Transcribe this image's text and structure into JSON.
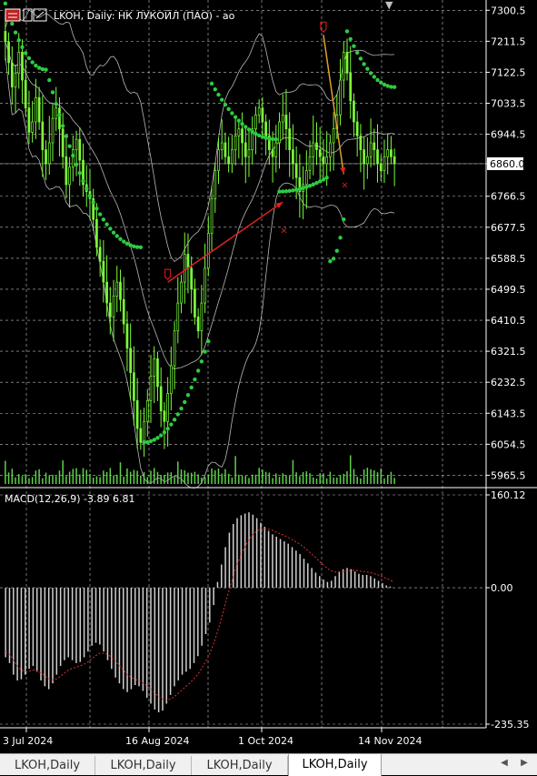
{
  "window": {
    "title": "LKOH, Daily:  НК ЛУКОЙЛ (ПАО) - ао"
  },
  "colors": {
    "background": "#000000",
    "grid": "#c0c0c0",
    "candle": "#7cfc3a",
    "sar": "#2ecc40",
    "bands": "#b8b8b8",
    "volume": "#5fd04a",
    "arrow": "#e02020",
    "price_label_bg": "#ffffff",
    "macd_histogram": "#d0d0d0",
    "macd_signal": "#e03030"
  },
  "chart_data": [
    {
      "type": "candlestick",
      "title": "LKOH, Daily:  НК ЛУКОЙЛ (ПАО) - ао",
      "x_tick_labels": [
        "3 Jul 2024",
        "16 Aug 2024",
        "1 Oct 2024",
        "14 Nov 2024"
      ],
      "y_tick_labels": [
        "7300.5",
        "7211.5",
        "7122.5",
        "7033.5",
        "6944.5",
        "6860.0",
        "6766.5",
        "6677.5",
        "6588.5",
        "6499.5",
        "6410.5",
        "6321.5",
        "6232.5",
        "6143.5",
        "6054.5",
        "5965.5"
      ],
      "current_price": "6860.0",
      "ylim": [
        5930,
        7330
      ],
      "grid": true,
      "indicators": [
        "Parabolic SAR",
        "Bollinger Bands",
        "Volume"
      ],
      "close_series": [
        7210,
        7150,
        7080,
        7120,
        7180,
        7100,
        7020,
        6950,
        6980,
        7050,
        6980,
        6900,
        6860,
        6920,
        6990,
        7020,
        6960,
        6880,
        6800,
        6850,
        6900,
        6930,
        6870,
        6800,
        6780,
        6760,
        6700,
        6620,
        6580,
        6520,
        6460,
        6420,
        6480,
        6520,
        6470,
        6400,
        6330,
        6260,
        6180,
        6100,
        6060,
        6120,
        6180,
        6250,
        6300,
        6220,
        6150,
        6120,
        6200,
        6280,
        6380,
        6460,
        6520,
        6600,
        6560,
        6500,
        6420,
        6380,
        6460,
        6560,
        6660,
        6760,
        6840,
        6900,
        6920,
        6880,
        6860,
        6900,
        6940,
        6960,
        6920,
        6880,
        6900,
        6960,
        7000,
        7020,
        6980,
        6940,
        6900,
        6880,
        6920,
        6980,
        7000,
        6960,
        6900,
        6860,
        6820,
        6780,
        6800,
        6840,
        6880,
        6920,
        6900,
        6880,
        6860,
        6880,
        6920,
        6960,
        7000,
        7100,
        7180,
        7120,
        7040,
        6980,
        6940,
        6900,
        6860,
        6880,
        6920,
        6900,
        6860,
        6840,
        6880,
        6900,
        6880,
        6860
      ],
      "sar_series": [
        {
          "start": 0,
          "end": 12,
          "trend": "down",
          "from": 7320,
          "to": 7130
        },
        {
          "start": 13,
          "end": 40,
          "trend": "down",
          "from": 7100,
          "to": 6620
        },
        {
          "start": 41,
          "end": 60,
          "trend": "up",
          "from": 6060,
          "to": 6350
        },
        {
          "start": 61,
          "end": 80,
          "trend": "down",
          "from": 7090,
          "to": 6930
        },
        {
          "start": 81,
          "end": 95,
          "trend": "up",
          "from": 6780,
          "to": 6820
        },
        {
          "start": 96,
          "end": 100,
          "trend": "up",
          "from": 6580,
          "to": 6700
        },
        {
          "start": 101,
          "end": 115,
          "trend": "down",
          "from": 7240,
          "to": 7080
        }
      ],
      "trades": [
        {
          "from_index": 48,
          "from_price": 6520,
          "to_index": 82,
          "to_price": 6750,
          "direction": "buy"
        },
        {
          "from_index": 94,
          "from_price": 7230,
          "to_index": 100,
          "to_price": 6830,
          "direction": "sell"
        }
      ]
    },
    {
      "type": "histogram",
      "title": "MACD(12,26,9) -3.89 6.81",
      "y_tick_labels": [
        "160.12",
        "0.00",
        "-235.35"
      ],
      "ylim": [
        -235.35,
        160.12
      ],
      "series": [
        {
          "name": "MACD",
          "values": [
            -120,
            -130,
            -150,
            -160,
            -158,
            -150,
            -140,
            -135,
            -145,
            -160,
            -170,
            -175,
            -165,
            -150,
            -135,
            -125,
            -120,
            -125,
            -130,
            -128,
            -120,
            -110,
            -100,
            -95,
            -98,
            -110,
            -125,
            -140,
            -155,
            -165,
            -175,
            -180,
            -175,
            -168,
            -170,
            -178,
            -190,
            -200,
            -210,
            -215,
            -212,
            -200,
            -185,
            -170,
            -160,
            -150,
            -145,
            -140,
            -130,
            -118,
            -100,
            -80,
            -60,
            -30,
            10,
            40,
            70,
            95,
            110,
            120,
            125,
            128,
            130,
            126,
            120,
            112,
            105,
            98,
            92,
            88,
            84,
            80,
            76,
            70,
            64,
            58,
            50,
            42,
            34,
            26,
            20,
            14,
            10,
            12,
            20,
            28,
            32,
            34,
            32,
            28,
            24,
            22,
            22,
            20,
            16,
            12,
            8,
            4,
            2,
            0
          ]
        },
        {
          "name": "Signal",
          "values": [
            -110,
            -115,
            -125,
            -135,
            -142,
            -145,
            -144,
            -142,
            -143,
            -147,
            -152,
            -157,
            -159,
            -157,
            -153,
            -147,
            -142,
            -139,
            -137,
            -135,
            -132,
            -128,
            -122,
            -117,
            -113,
            -113,
            -115,
            -120,
            -127,
            -134,
            -142,
            -150,
            -155,
            -158,
            -160,
            -164,
            -169,
            -175,
            -182,
            -188,
            -192,
            -194,
            -192,
            -188,
            -182,
            -176,
            -170,
            -164,
            -157,
            -149,
            -139,
            -127,
            -114,
            -97,
            -76,
            -52,
            -27,
            -3,
            20,
            40,
            57,
            71,
            83,
            92,
            98,
            101,
            102,
            101,
            99,
            96,
            93,
            90,
            87,
            83,
            79,
            75,
            70,
            64,
            58,
            52,
            45,
            39,
            33,
            29,
            27,
            27,
            28,
            29,
            30,
            30,
            29,
            28,
            27,
            26,
            24,
            22,
            19,
            16,
            13,
            10
          ]
        }
      ]
    }
  ],
  "tabs": [
    {
      "label": "LKOH,Daily"
    },
    {
      "label": "LKOH,Daily"
    },
    {
      "label": "LKOH,Daily"
    },
    {
      "label": "LKOH,Daily"
    }
  ],
  "tab_nav": {
    "left": "◀",
    "right": "▶"
  },
  "top_marker": "▼"
}
